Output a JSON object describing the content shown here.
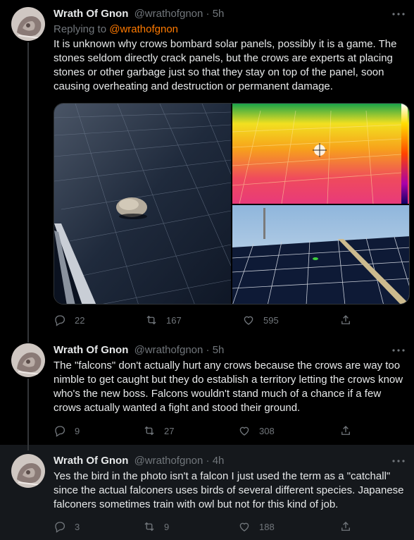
{
  "tweets": [
    {
      "author": {
        "name": "Wrath Of Gnon",
        "handle": "@wrathofgnon"
      },
      "time": "5h",
      "replying_label": "Replying to",
      "replying_to": "@wrathofgnon",
      "text": "It is unknown why crows bombard solar panels, possibly it is a game. The stones seldom directly crack panels, but the crows are experts at placing stones or other garbage just so that they stay on top of the panel, soon causing overheating and destruction or permanent damage.",
      "metrics": {
        "replies": "22",
        "retweets": "167",
        "likes": "595"
      }
    },
    {
      "author": {
        "name": "Wrath Of Gnon",
        "handle": "@wrathofgnon"
      },
      "time": "5h",
      "text": "The \"falcons\" don't actually hurt any crows because the crows are way too nimble to get caught but they do establish a territory letting the crows know who's the new boss. Falcons wouldn't stand much of a chance if a few crows actually wanted a fight and stood their ground.",
      "metrics": {
        "replies": "9",
        "retweets": "27",
        "likes": "308"
      }
    },
    {
      "author": {
        "name": "Wrath Of Gnon",
        "handle": "@wrathofgnon"
      },
      "time": "4h",
      "text": "Yes the bird in the photo isn't a falcon I just used the term as a \"catchall\" since the actual falconers uses birds of several different species. Japanese falconers sometimes train with owl but not for this kind of job.",
      "metrics": {
        "replies": "3",
        "retweets": "9",
        "likes": "188"
      }
    }
  ],
  "separator": "·",
  "icons": {
    "reply": "reply-bubble-icon",
    "retweet": "retweet-arrows-icon",
    "like": "heart-icon",
    "share": "share-upload-icon",
    "more": "more-dots-icon"
  },
  "colors": {
    "background": "#000000",
    "highlight_background": "#15181c",
    "text": "#e7e9ea",
    "secondary": "#71767b",
    "mention": "#ff7a00"
  }
}
